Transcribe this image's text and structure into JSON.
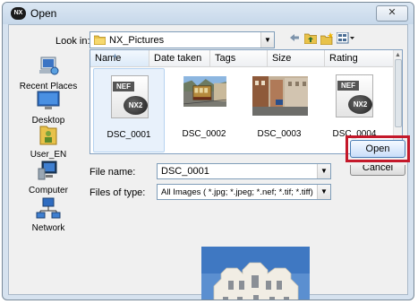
{
  "window": {
    "title": "Open",
    "close_glyph": "✕",
    "app_icon_text": "NX"
  },
  "lookin": {
    "label": "Look in:",
    "value": "NX_Pictures"
  },
  "toolbar": {
    "icons": [
      "back-arrow-icon",
      "up-folder-icon",
      "new-folder-icon",
      "view-menu-icon"
    ]
  },
  "places": [
    {
      "label": "Recent Places",
      "icon": "recent-places-icon"
    },
    {
      "label": "Desktop",
      "icon": "desktop-icon"
    },
    {
      "label": "User_EN",
      "icon": "user-folder-icon"
    },
    {
      "label": "Computer",
      "icon": "computer-icon"
    },
    {
      "label": "Network",
      "icon": "network-icon"
    }
  ],
  "columns": [
    "Name",
    "Date taken",
    "Tags",
    "Size",
    "Rating"
  ],
  "files": [
    {
      "name": "DSC_0001",
      "type": "nef",
      "tag": "NEF",
      "badge": "NX2",
      "selected": true
    },
    {
      "name": "DSC_0002",
      "type": "photo",
      "selected": false
    },
    {
      "name": "DSC_0003",
      "type": "photo",
      "selected": false
    },
    {
      "name": "DSC_0004",
      "type": "nef",
      "tag": "NEF",
      "badge": "NX2",
      "selected": false
    }
  ],
  "filename": {
    "label": "File name:",
    "value": "DSC_0001"
  },
  "filetype": {
    "label": "Files of type:",
    "value": "All Images ( *.jpg; *.jpeg; *.nef; *.tif; *.tiff)"
  },
  "buttons": {
    "open": "Open",
    "cancel": "Cancel"
  },
  "colors": {
    "highlight": "#c4182a",
    "selection": "#e8f1fb",
    "title_bg": "#d6e2ef"
  }
}
